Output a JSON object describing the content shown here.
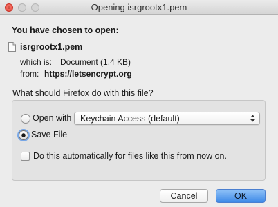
{
  "window": {
    "title": "Opening isrgrootx1.pem"
  },
  "dialog": {
    "heading": "You have chosen to open:",
    "file_name": "isrgrootx1.pem",
    "file_icon": "document-icon",
    "which_is_label": "which is:",
    "which_is_value": "Document (1.4 KB)",
    "from_label": "from:",
    "from_value": "https://letsencrypt.org",
    "question": "What should Firefox do with this file?"
  },
  "options": {
    "open_with_label": "Open with",
    "open_with_selected": false,
    "open_with_app": "Keychain Access (default)",
    "save_file_label": "Save File",
    "save_file_selected": true,
    "auto_label": "Do this automatically for files like this from now on.",
    "auto_checked": false
  },
  "buttons": {
    "cancel": "Cancel",
    "ok": "OK"
  },
  "colors": {
    "accent": "#3f8ae8",
    "close_button": "#e0443a",
    "background": "#ececec"
  }
}
